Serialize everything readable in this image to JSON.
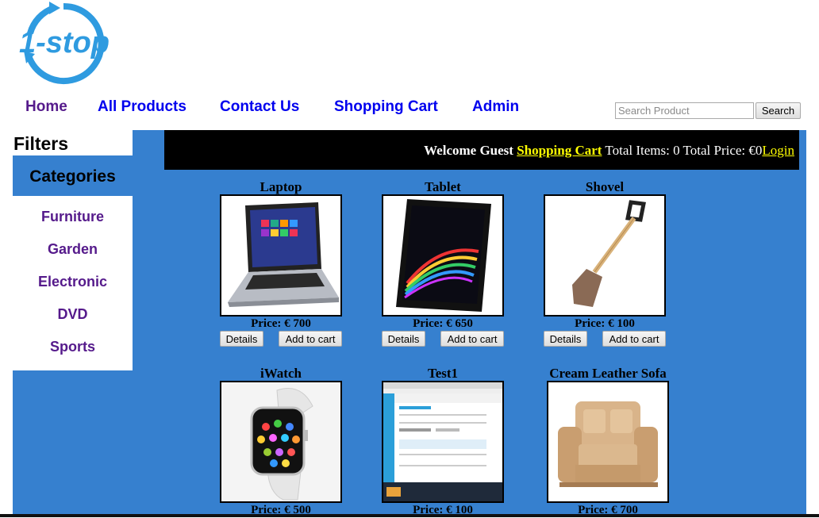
{
  "logo": {
    "text": "1-stop"
  },
  "nav": [
    {
      "label": "Home",
      "visited": true
    },
    {
      "label": "All Products",
      "visited": false
    },
    {
      "label": "Contact Us",
      "visited": false
    },
    {
      "label": "Shopping Cart",
      "visited": false
    },
    {
      "label": "Admin",
      "visited": false
    }
  ],
  "search": {
    "placeholder": "Search Product",
    "button_label": "Search"
  },
  "sidebar": {
    "filters_title": "Filters",
    "categories_title": "Categories",
    "categories": [
      "Furniture",
      "Garden",
      "Electronic",
      "DVD",
      "Sports"
    ]
  },
  "welcome_bar": {
    "greeting": "Welcome Guest",
    "cart_link": "Shopping Cart",
    "total_items_label": "Total Items:",
    "total_items": "0",
    "total_price_label": "Total Price: €",
    "total_price": "0",
    "login_link": "Login"
  },
  "product_buttons": {
    "details": "Details",
    "add": "Add to cart"
  },
  "products": [
    {
      "name": "Laptop",
      "price": "Price: € 700",
      "image": "laptop"
    },
    {
      "name": "Tablet",
      "price": "Price: € 650",
      "image": "tablet"
    },
    {
      "name": "Shovel",
      "price": "Price: € 100",
      "image": "shovel"
    },
    {
      "name": "iWatch",
      "price": "Price: € 500",
      "image": "watch"
    },
    {
      "name": "Test1",
      "price": "Price: € 100",
      "image": "screenshot"
    },
    {
      "name": "Cream Leather Sofa",
      "price": "Price: € 700",
      "image": "sofa"
    }
  ],
  "colors": {
    "accent": "#3680cf",
    "link": "#0000ee",
    "visited_link": "#551a8b",
    "highlight": "#ffff00"
  }
}
